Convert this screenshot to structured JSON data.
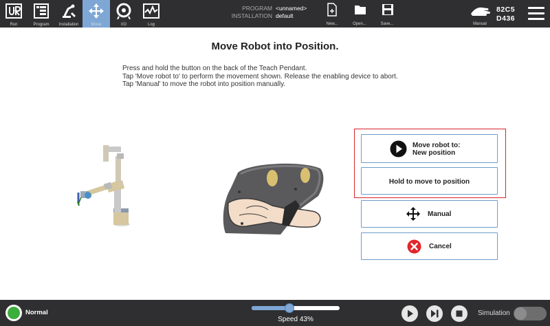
{
  "topbar": {
    "nav": [
      {
        "id": "run",
        "label": "Run",
        "icon": "ur-logo-icon"
      },
      {
        "id": "program",
        "label": "Program",
        "icon": "program-icon"
      },
      {
        "id": "installation",
        "label": "Installation",
        "icon": "installation-icon"
      },
      {
        "id": "move",
        "label": "Move",
        "icon": "move-icon",
        "active": true
      },
      {
        "id": "io",
        "label": "I/O",
        "icon": "io-icon"
      },
      {
        "id": "log",
        "label": "Log",
        "icon": "log-icon"
      }
    ],
    "program_label": "PROGRAM",
    "program_value": "<unnamed>",
    "installation_label": "INSTALLATION",
    "installation_value": "default",
    "file_buttons": [
      {
        "label": "New...",
        "icon": "new-file-icon"
      },
      {
        "label": "Open...",
        "icon": "folder-icon"
      },
      {
        "label": "Save...",
        "icon": "save-icon"
      }
    ],
    "mode_label": "Manual",
    "robot_id_line1": "82C5",
    "robot_id_line2": "D436"
  },
  "main": {
    "title": "Move Robot into Position.",
    "instructions": [
      "Press and hold the button on the back of the Teach Pendant.",
      "Tap 'Move robot to' to perform the movement shown. Release the enabling device to abort.",
      "Tap 'Manual' to move the robot into position manually."
    ],
    "buttons": {
      "move_robot_line1": "Move robot to:",
      "move_robot_line2": "New position",
      "hold_to_move": "Hold to move to position",
      "manual": "Manual",
      "cancel": "Cancel"
    },
    "colors": {
      "highlight": "#d8232a",
      "button_border": "#6e9bc9",
      "cancel_red": "#e1262b"
    }
  },
  "bottombar": {
    "status": "Normal",
    "status_color": "#3cae3c",
    "speed_text": "Speed 43%",
    "speed_value": 43,
    "simulation_label": "Simulation"
  }
}
